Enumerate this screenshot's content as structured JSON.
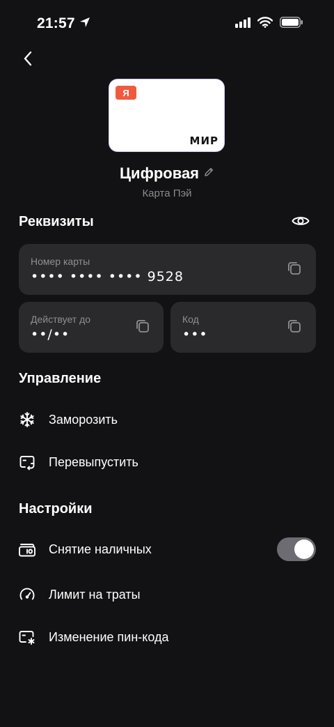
{
  "status_bar": {
    "time": "21:57"
  },
  "card": {
    "badge": "Я",
    "payment_system": "МИР",
    "title": "Цифровая",
    "subtitle": "Карта Пэй"
  },
  "requisites": {
    "title": "Реквизиты",
    "card_number": {
      "label": "Номер карты",
      "value": "•••• •••• •••• 9528"
    },
    "valid_thru": {
      "label": "Действует до",
      "value": "••/••"
    },
    "code": {
      "label": "Код",
      "value": "•••"
    }
  },
  "management": {
    "title": "Управление",
    "items": [
      {
        "label": "Заморозить",
        "icon": "snowflake-icon"
      },
      {
        "label": "Перевыпустить",
        "icon": "reissue-card-icon"
      }
    ]
  },
  "settings": {
    "title": "Настройки",
    "items": [
      {
        "label": "Снятие наличных",
        "icon": "cash-withdrawal-icon",
        "toggle_on": true
      },
      {
        "label": "Лимит на траты",
        "icon": "speedometer-icon"
      },
      {
        "label": "Изменение пин-кода",
        "icon": "pin-card-icon"
      }
    ]
  },
  "colors": {
    "background": "#121214",
    "field_background": "#2a2a2d",
    "badge": "#f15a3f",
    "toggle_track": "#6c6c72"
  }
}
